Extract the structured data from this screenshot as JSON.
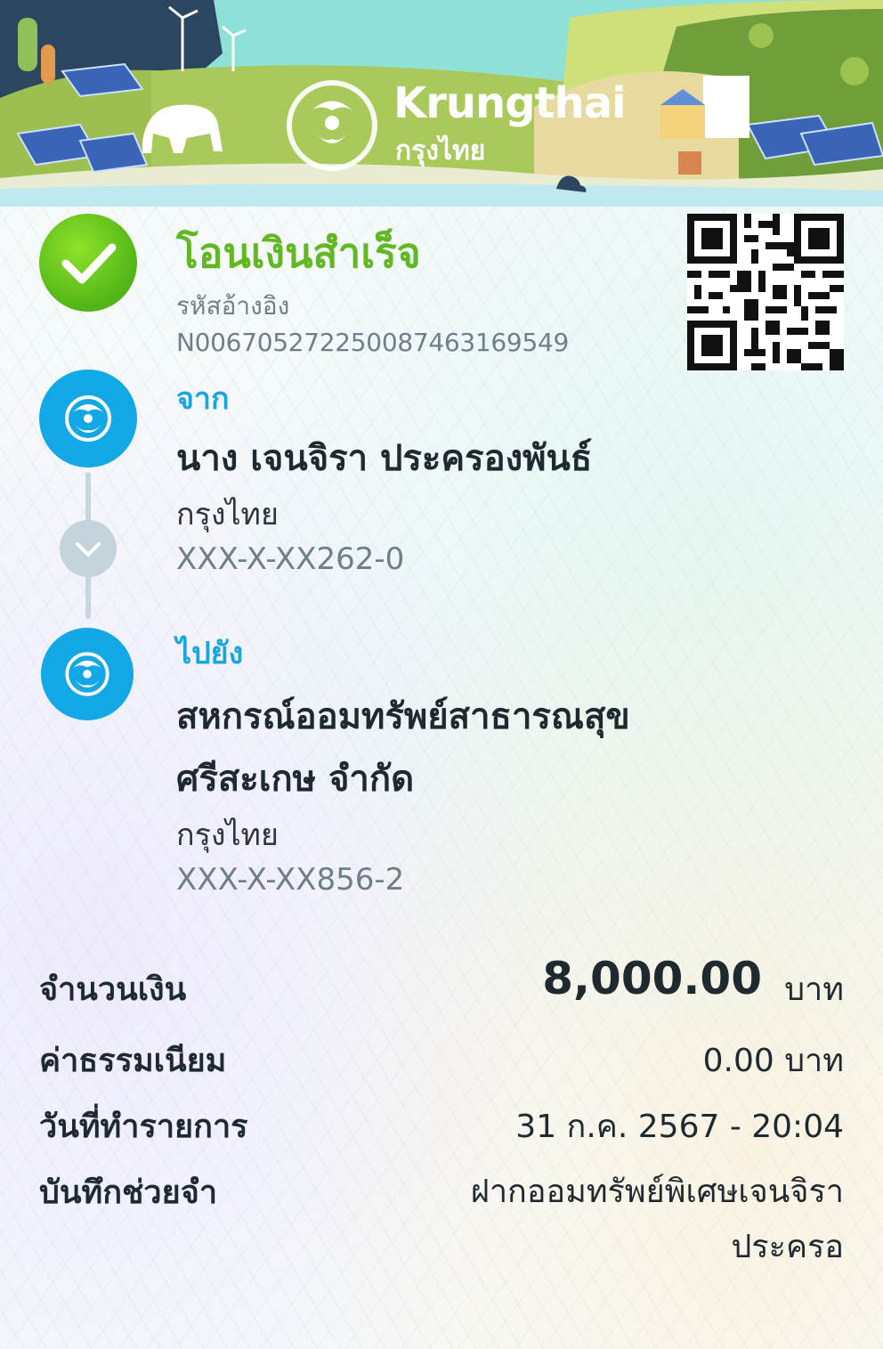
{
  "brand": {
    "name_en": "Krungthai",
    "name_th": "กรุงไทย"
  },
  "status": {
    "title": "โอนเงินสำเร็จ",
    "icon": "check-circle-icon",
    "color": "#62b824"
  },
  "reference": {
    "label": "รหัสอ้างอิง",
    "value": "N006705272250087463169549"
  },
  "qr": {
    "icon": "qr-code-icon"
  },
  "from": {
    "label": "จาก",
    "name": "นาง เจนจิรา ประครองพันธ์",
    "bank": "กรุงไทย",
    "account": "XXX-X-XX262-0"
  },
  "to": {
    "label": "ไปยัง",
    "name_line1": "สหกรณ์ออมทรัพย์สาธารณสุข",
    "name_line2": "ศรีสะเกษ จำกัด",
    "bank": "กรุงไทย",
    "account": "XXX-X-XX856-2"
  },
  "details": {
    "amount_label": "จำนวนเงิน",
    "amount_value": "8,000.00",
    "amount_unit": "บาท",
    "fee_label": "ค่าธรรมเนียม",
    "fee_value": "0.00 บาท",
    "date_label": "วันที่ทำรายการ",
    "date_value": "31 ก.ค. 2567 - 20:04",
    "note_label": "บันทึกช่วยจำ",
    "note_value": "ฝากออมทรัพย์พิเศษเจนจิราประครอ"
  },
  "colors": {
    "accent_blue": "#12a7e6",
    "success_green": "#62b824",
    "text_gray": "#6e7f8a"
  }
}
